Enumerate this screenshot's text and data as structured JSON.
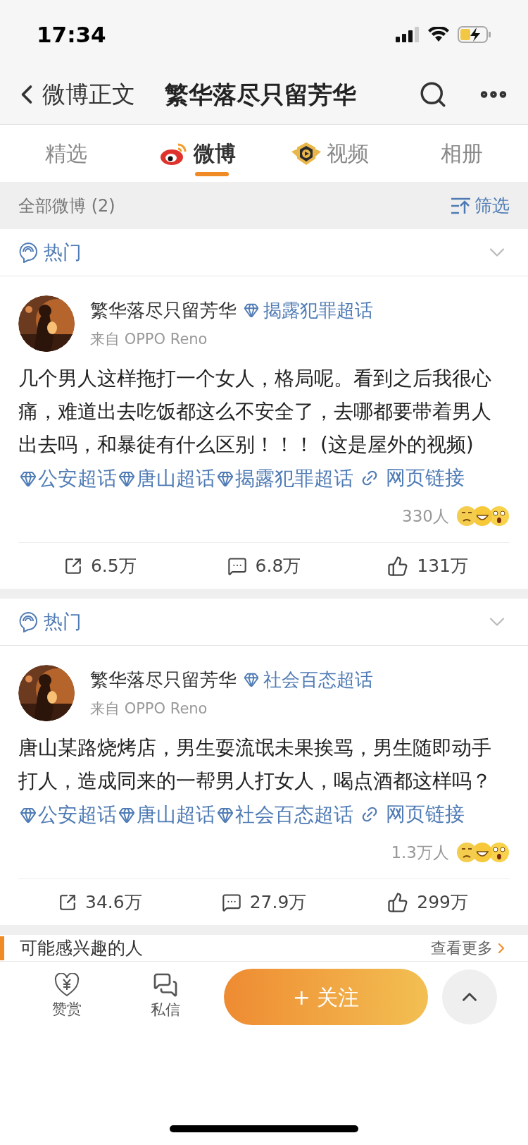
{
  "status_bar": {
    "time": "17:34"
  },
  "nav": {
    "back_label": "微博正文",
    "title": "繁华落尽只留芳华"
  },
  "tabs": [
    {
      "label": "精选",
      "selected": false,
      "kind": "plain"
    },
    {
      "label": "微博",
      "selected": true,
      "kind": "weibo"
    },
    {
      "label": "视频",
      "selected": false,
      "kind": "video"
    },
    {
      "label": "相册",
      "selected": false,
      "kind": "plain"
    }
  ],
  "filter_bar": {
    "count_label": "全部微博 (2)",
    "filter_label": "筛选"
  },
  "posts": [
    {
      "section_label": "热门",
      "author": "繁华落尽只留芳华",
      "topic": "揭露犯罪超话",
      "source": "来自 OPPO Reno",
      "body": [
        {
          "kind": "text",
          "text": "几个男人这样拖打一个女人，格局呢。看到之后我很心痛，难道出去吃饭都这么不安全了，去哪都要带着男人出去吗，和暴徒有什么区别！！！ (这是屋外的视频)"
        },
        {
          "kind": "topic",
          "text": "公安超话"
        },
        {
          "kind": "topic",
          "text": "唐山超话"
        },
        {
          "kind": "topic",
          "text": "揭露犯罪超话"
        },
        {
          "kind": "link",
          "text": "网页链接"
        }
      ],
      "reaction_count": "330人",
      "reposts": "6.5万",
      "comments": "6.8万",
      "likes": "131万"
    },
    {
      "section_label": "热门",
      "author": "繁华落尽只留芳华",
      "topic": "社会百态超话",
      "source": "来自 OPPO Reno",
      "body": [
        {
          "kind": "text",
          "text": "唐山某路烧烤店，男生耍流氓未果挨骂，男生随即动手打人，造成同来的一帮男人打女人，喝点酒都这样吗？"
        },
        {
          "kind": "topic",
          "text": "公安超话"
        },
        {
          "kind": "topic",
          "text": "唐山超话"
        },
        {
          "kind": "topic",
          "text": "社会百态超话"
        },
        {
          "kind": "link",
          "text": "网页链接"
        }
      ],
      "reaction_count": "1.3万人",
      "reposts": "34.6万",
      "comments": "27.9万",
      "likes": "299万"
    }
  ],
  "recommend": {
    "title": "可能感兴趣的人",
    "more": "查看更多"
  },
  "bottom_bar": {
    "reward": "赞赏",
    "message": "私信",
    "follow": "+ 关注"
  }
}
